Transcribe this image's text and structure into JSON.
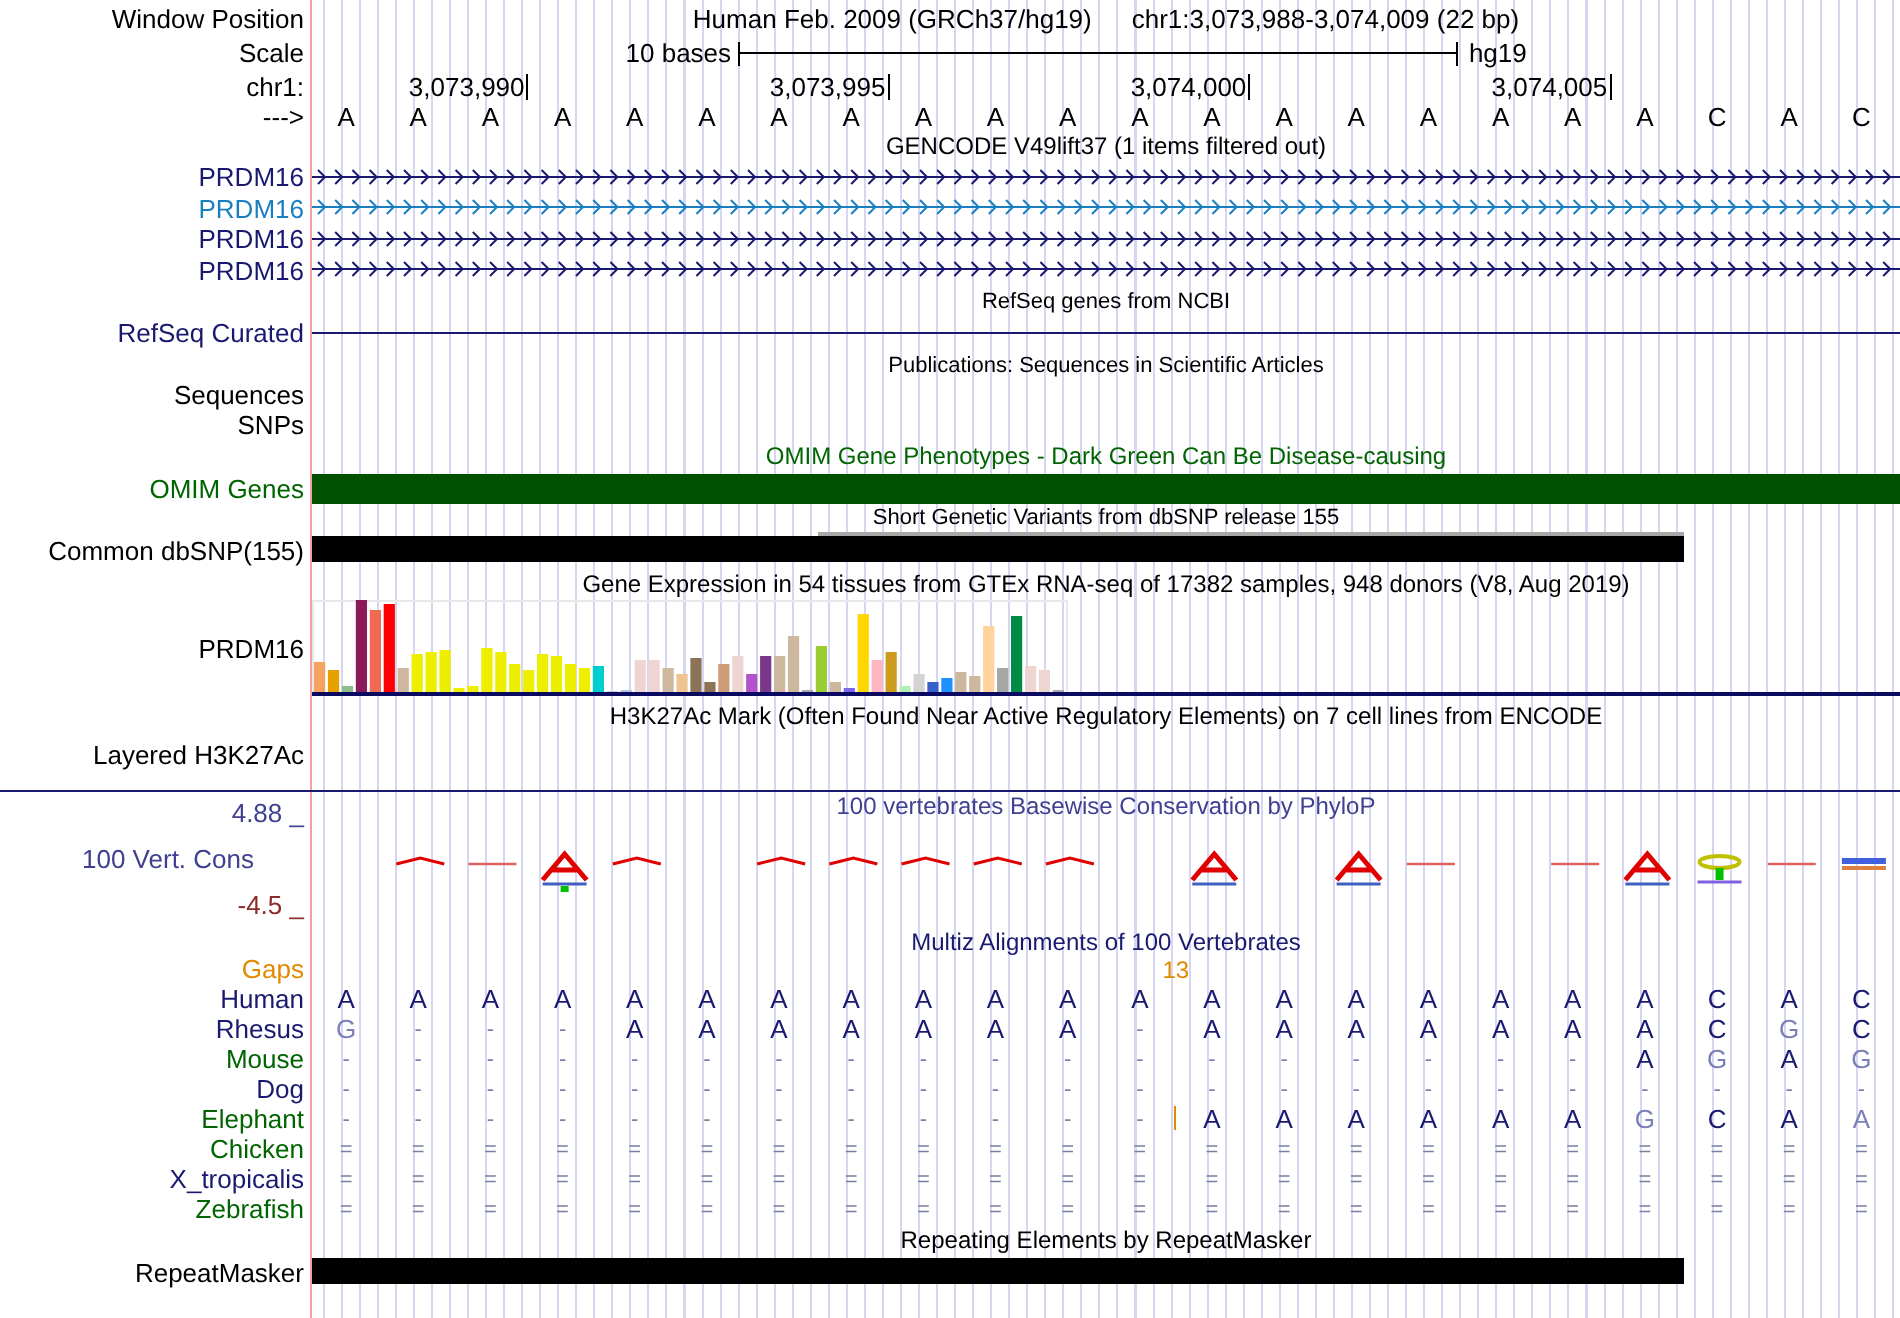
{
  "header": {
    "position_label": "Window Position",
    "assembly": "Human Feb. 2009 (GRCh37/hg19)",
    "position": "chr1:3,073,988-3,074,009 (22 bp)",
    "scale_label": "Scale",
    "scale_text": "10 bases",
    "scale_db": "hg19",
    "chrom_label": "chr1:",
    "ticks": [
      "3,073,990",
      "3,073,995",
      "3,074,000",
      "3,074,005"
    ],
    "strand_label": "--->",
    "bases": [
      "A",
      "A",
      "A",
      "A",
      "A",
      "A",
      "A",
      "A",
      "A",
      "A",
      "A",
      "A",
      "A",
      "A",
      "A",
      "A",
      "A",
      "A",
      "A",
      "C",
      "A",
      "C"
    ]
  },
  "gencode": {
    "title": "GENCODE V49lift37 (1 items filtered out)",
    "genes": [
      {
        "name": "PRDM16",
        "color": "#191970"
      },
      {
        "name": "PRDM16",
        "color": "#1a7fc0"
      },
      {
        "name": "PRDM16",
        "color": "#191970"
      },
      {
        "name": "PRDM16",
        "color": "#191970"
      }
    ]
  },
  "refseq": {
    "title": "RefSeq genes from NCBI",
    "label": "RefSeq Curated"
  },
  "publications": {
    "title": "Publications: Sequences in Scientific Articles",
    "labels": [
      "Sequences",
      "SNPs"
    ]
  },
  "omim": {
    "title": "OMIM Gene Phenotypes - Dark Green Can Be Disease-causing",
    "label": "OMIM Genes"
  },
  "dbsnp": {
    "title": "Short Genetic Variants from dbSNP release 155",
    "label": "Common dbSNP(155)"
  },
  "gtex": {
    "title": "Gene Expression in 54 tissues from GTEx RNA-seq of 17382 samples, 948 donors (V8, Aug 2019)",
    "label": "PRDM16"
  },
  "h3k27ac": {
    "title": "H3K27Ac Mark (Often Found Near Active Regulatory Elements) on 7 cell lines from ENCODE",
    "label": "Layered H3K27Ac"
  },
  "phylop": {
    "title": "100 vertebrates Basewise Conservation by PhyloP",
    "label": "100 Vert. Cons",
    "max": "4.88 _",
    "min": "-4.5 _"
  },
  "multiz": {
    "title": "Multiz Alignments of 100 Vertebrates",
    "gaps_label": "Gaps",
    "gaps_count": "13",
    "species": [
      {
        "name": "Human",
        "color": "#191970",
        "bases": [
          "A",
          "A",
          "A",
          "A",
          "A",
          "A",
          "A",
          "A",
          "A",
          "A",
          "A",
          "A",
          "A",
          "A",
          "A",
          "A",
          "A",
          "A",
          "A",
          "C",
          "A",
          "C"
        ]
      },
      {
        "name": "Rhesus",
        "color": "#191970",
        "bases": [
          "G",
          "-",
          "-",
          "-",
          "A",
          "A",
          "A",
          "A",
          "A",
          "A",
          "A",
          "-",
          "A",
          "A",
          "A",
          "A",
          "A",
          "A",
          "A",
          "C",
          "G",
          "C"
        ]
      },
      {
        "name": "Mouse",
        "color": "#006400",
        "bases": [
          "-",
          "-",
          "-",
          "-",
          "-",
          "-",
          "-",
          "-",
          "-",
          "-",
          "-",
          "-",
          "-",
          "-",
          "-",
          "-",
          "-",
          "-",
          "A",
          "G",
          "A",
          "G"
        ]
      },
      {
        "name": "Dog",
        "color": "#191970",
        "bases": [
          "-",
          "-",
          "-",
          "-",
          "-",
          "-",
          "-",
          "-",
          "-",
          "-",
          "-",
          "-",
          "-",
          "-",
          "-",
          "-",
          "-",
          "-",
          "-",
          "-",
          "-",
          "-"
        ]
      },
      {
        "name": "Elephant",
        "color": "#006400",
        "bases": [
          "-",
          "-",
          "-",
          "-",
          "-",
          "-",
          "-",
          "-",
          "-",
          "-",
          "-",
          "-",
          {
            "base": "A",
            "insertion": true
          },
          "A",
          "A",
          "A",
          "A",
          "A",
          "G",
          "C",
          "A",
          "A"
        ]
      },
      {
        "name": "Chicken",
        "color": "#006400",
        "bases": [
          "=",
          "=",
          "=",
          "=",
          "=",
          "=",
          "=",
          "=",
          "=",
          "=",
          "=",
          "=",
          "=",
          "=",
          "=",
          "=",
          "=",
          "=",
          "=",
          "=",
          "=",
          "="
        ]
      },
      {
        "name": "X_tropicalis",
        "color": "#191970",
        "bases": [
          "=",
          "=",
          "=",
          "=",
          "=",
          "=",
          "=",
          "=",
          "=",
          "=",
          "=",
          "=",
          "=",
          "=",
          "=",
          "=",
          "=",
          "=",
          "=",
          "=",
          "=",
          "="
        ]
      },
      {
        "name": "Zebrafish",
        "color": "#006400",
        "bases": [
          "=",
          "=",
          "=",
          "=",
          "=",
          "=",
          "=",
          "=",
          "=",
          "=",
          "=",
          "=",
          "=",
          "=",
          "=",
          "=",
          "=",
          "=",
          "=",
          "=",
          "=",
          "="
        ]
      }
    ]
  },
  "repeatmasker": {
    "title": "Repeating Elements by RepeatMasker",
    "label": "RepeatMasker"
  }
}
